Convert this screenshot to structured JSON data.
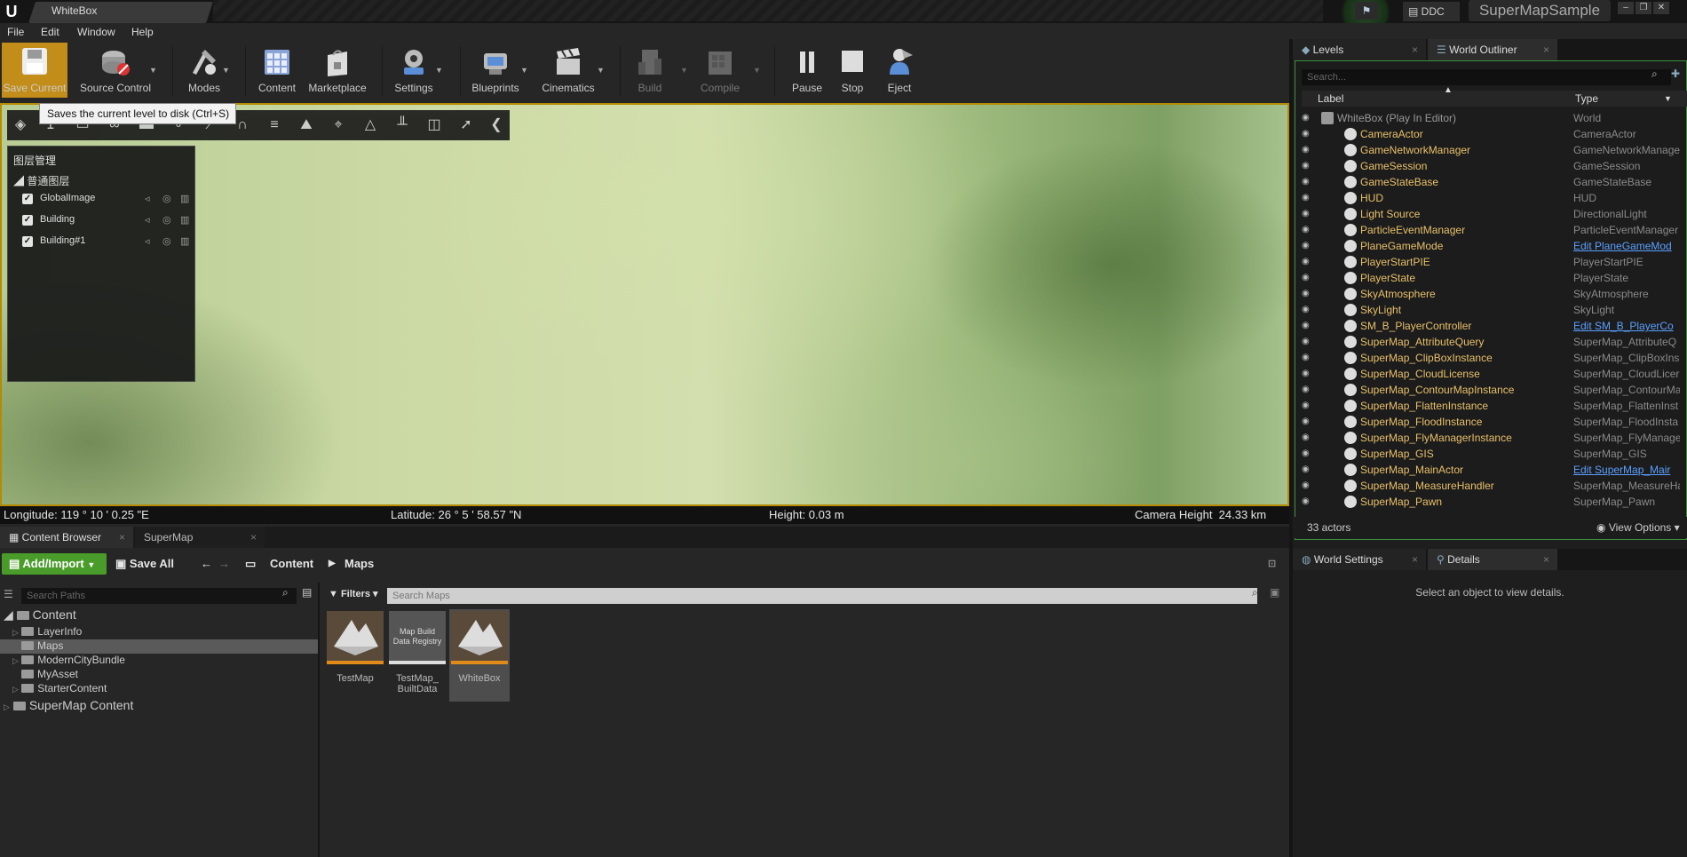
{
  "window": {
    "tab_title": "WhiteBox",
    "ddc_label": "DDC",
    "project_name": "SuperMapSample"
  },
  "menu": [
    "File",
    "Edit",
    "Window",
    "Help"
  ],
  "toolbar": {
    "buttons": [
      {
        "label": "Save Current",
        "icon": "save-icon"
      },
      {
        "label": "Source Control",
        "icon": "source-control-icon"
      },
      {
        "label": "Modes",
        "icon": "modes-icon"
      },
      {
        "label": "Content",
        "icon": "content-icon"
      },
      {
        "label": "Marketplace",
        "icon": "marketplace-icon"
      },
      {
        "label": "Settings",
        "icon": "settings-icon"
      },
      {
        "label": "Blueprints",
        "icon": "blueprints-icon"
      },
      {
        "label": "Cinematics",
        "icon": "cinematics-icon"
      },
      {
        "label": "Build",
        "icon": "build-icon"
      },
      {
        "label": "Compile",
        "icon": "compile-icon"
      },
      {
        "label": "Pause",
        "icon": "pause-icon"
      },
      {
        "label": "Stop",
        "icon": "stop-icon"
      },
      {
        "label": "Eject",
        "icon": "eject-icon"
      }
    ],
    "tooltip": "Saves the current level to disk (Ctrl+S)"
  },
  "layer_panel": {
    "title": "图层管理",
    "group": "普通图层",
    "layers": [
      {
        "name": "GlobalImage",
        "checked": true
      },
      {
        "name": "Building",
        "checked": true
      },
      {
        "name": "Building#1",
        "checked": true
      }
    ]
  },
  "status": {
    "longitude": "Longitude: 119 ° 10 ' 0.25 \"E",
    "latitude": "Latitude: 26 ° 5 ' 58.57 \"N",
    "height": "Height: 0.03 m",
    "camera_height": "Camera Height  24.33 km"
  },
  "content_browser": {
    "tabs": [
      "Content Browser",
      "SuperMap"
    ],
    "add_import": "Add/Import",
    "save_all": "Save All",
    "breadcrumb": [
      "Content",
      "Maps"
    ],
    "search_paths_placeholder": "Search Paths",
    "filters": "Filters",
    "search_maps_placeholder": "Search Maps",
    "tree": [
      {
        "label": "Content",
        "level": 0
      },
      {
        "label": "LayerInfo",
        "level": 1
      },
      {
        "label": "Maps",
        "level": 1,
        "selected": true
      },
      {
        "label": "ModernCityBundle",
        "level": 1
      },
      {
        "label": "MyAsset",
        "level": 1
      },
      {
        "label": "StarterContent",
        "level": 1
      },
      {
        "label": "SuperMap Content",
        "level": 0
      }
    ],
    "assets": [
      {
        "name": "TestMap",
        "thumb": ""
      },
      {
        "name": "TestMap_ BuiltData",
        "thumb": "Map Build Data Registry"
      },
      {
        "name": "WhiteBox",
        "thumb": ""
      }
    ]
  },
  "outliner": {
    "tabs": [
      "Levels",
      "World Outliner"
    ],
    "search_placeholder": "Search...",
    "col_label": "Label",
    "col_type": "Type",
    "actors": [
      {
        "label": "WhiteBox (Play In Editor)",
        "type": "World",
        "link": false
      },
      {
        "label": "CameraActor",
        "type": "CameraActor",
        "link": false
      },
      {
        "label": "GameNetworkManager",
        "type": "GameNetworkManager",
        "link": false
      },
      {
        "label": "GameSession",
        "type": "GameSession",
        "link": false
      },
      {
        "label": "GameStateBase",
        "type": "GameStateBase",
        "link": false
      },
      {
        "label": "HUD",
        "type": "HUD",
        "link": false
      },
      {
        "label": "Light Source",
        "type": "DirectionalLight",
        "link": false
      },
      {
        "label": "ParticleEventManager",
        "type": "ParticleEventManager",
        "link": false
      },
      {
        "label": "PlaneGameMode",
        "type": "Edit PlaneGameMod",
        "link": true
      },
      {
        "label": "PlayerStartPIE",
        "type": "PlayerStartPIE",
        "link": false
      },
      {
        "label": "PlayerState",
        "type": "PlayerState",
        "link": false
      },
      {
        "label": "SkyAtmosphere",
        "type": "SkyAtmosphere",
        "link": false
      },
      {
        "label": "SkyLight",
        "type": "SkyLight",
        "link": false
      },
      {
        "label": "SM_B_PlayerController",
        "type": "Edit SM_B_PlayerCo",
        "link": true
      },
      {
        "label": "SuperMap_AttributeQuery",
        "type": "SuperMap_AttributeQ",
        "link": false
      },
      {
        "label": "SuperMap_ClipBoxInstance",
        "type": "SuperMap_ClipBoxIns",
        "link": false
      },
      {
        "label": "SuperMap_CloudLicense",
        "type": "SuperMap_CloudLicer",
        "link": false
      },
      {
        "label": "SuperMap_ContourMapInstance",
        "type": "SuperMap_ContourMa",
        "link": false
      },
      {
        "label": "SuperMap_FlattenInstance",
        "type": "SuperMap_FlattenInst",
        "link": false
      },
      {
        "label": "SuperMap_FloodInstance",
        "type": "SuperMap_FloodInsta",
        "link": false
      },
      {
        "label": "SuperMap_FlyManagerInstance",
        "type": "SuperMap_FlyManage",
        "link": false
      },
      {
        "label": "SuperMap_GIS",
        "type": "SuperMap_GIS",
        "link": false
      },
      {
        "label": "SuperMap_MainActor",
        "type": "Edit SuperMap_Mair",
        "link": true
      },
      {
        "label": "SuperMap_MeasureHandler",
        "type": "SuperMap_MeasureHa",
        "link": false
      },
      {
        "label": "SuperMap_Pawn",
        "type": "SuperMap_Pawn",
        "link": false
      }
    ],
    "actor_count": "33 actors",
    "view_options": "View Options"
  },
  "details": {
    "tabs": [
      "World Settings",
      "Details"
    ],
    "empty_message": "Select an object to view details."
  },
  "colors": {
    "accent_green": "#4a9c2a",
    "selection_orange": "#b58b00",
    "actor_label": "#e8c06a",
    "link_blue": "#5aa0ff"
  }
}
